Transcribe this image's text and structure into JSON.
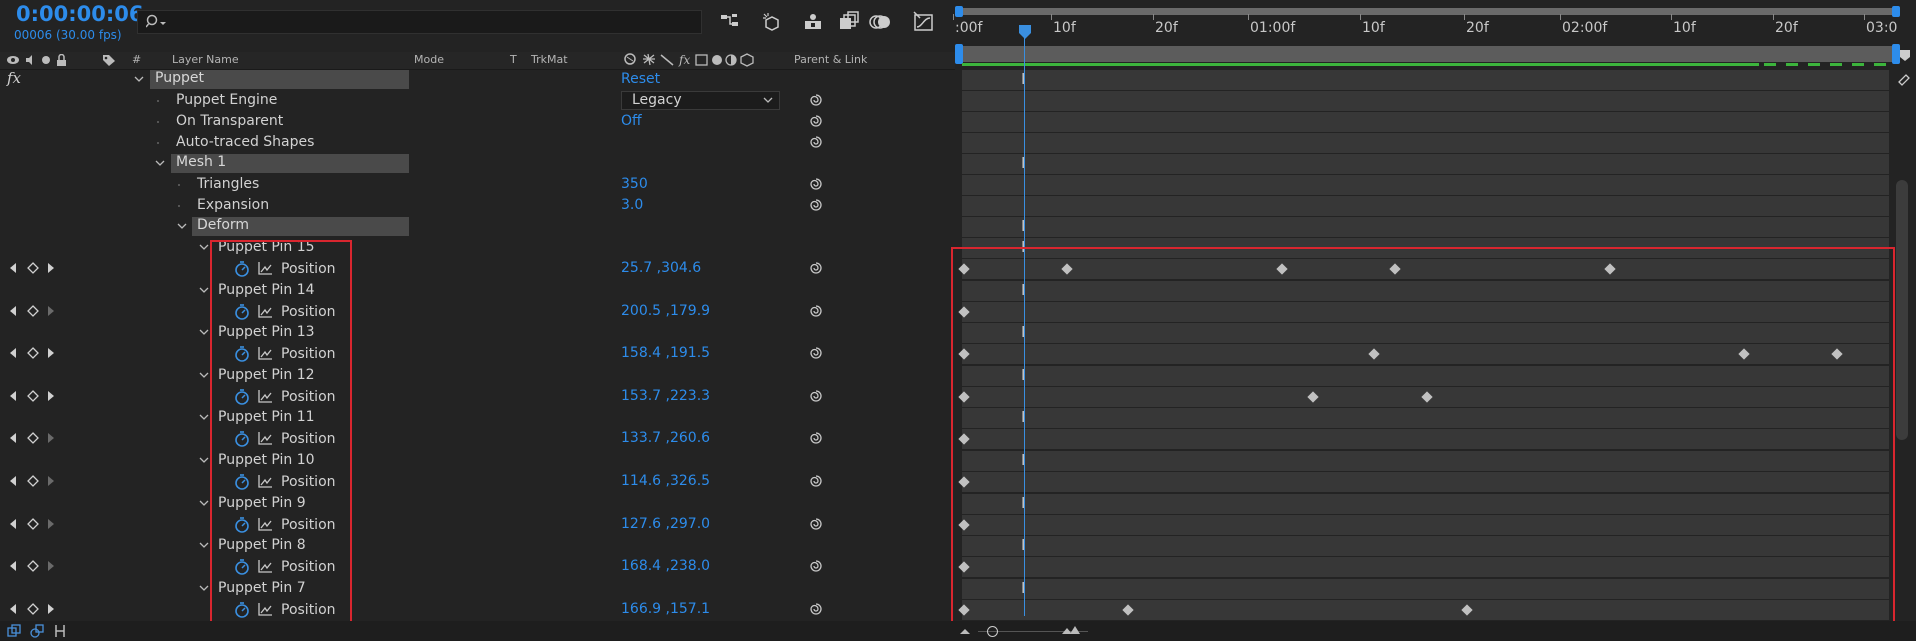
{
  "header": {
    "timecode": "0:00:00:06",
    "frames": "00006 (30.00 fps)"
  },
  "columns": {
    "layer_name": "Layer Name",
    "mode": "Mode",
    "t": "T",
    "trkmat": "TrkMat",
    "parent": "Parent & Link",
    "num": "#"
  },
  "effect": {
    "fx_label": "fx",
    "name": "Puppet",
    "reset": "Reset",
    "engine_label": "Puppet Engine",
    "engine_value": "Legacy",
    "on_transparent_label": "On Transparent",
    "on_transparent_value": "Off",
    "auto_traced_label": "Auto-traced Shapes",
    "mesh_label": "Mesh 1",
    "triangles_label": "Triangles",
    "triangles_value": "350",
    "expansion_label": "Expansion",
    "expansion_value": "3.0",
    "deform_label": "Deform"
  },
  "pins": [
    {
      "name": "Puppet Pin 15",
      "prop": "Position",
      "value": "25.7 ,304.6"
    },
    {
      "name": "Puppet Pin 14",
      "prop": "Position",
      "value": "200.5 ,179.9"
    },
    {
      "name": "Puppet Pin 13",
      "prop": "Position",
      "value": "158.4 ,191.5"
    },
    {
      "name": "Puppet Pin 12",
      "prop": "Position",
      "value": "153.7 ,223.3"
    },
    {
      "name": "Puppet Pin 11",
      "prop": "Position",
      "value": "133.7 ,260.6"
    },
    {
      "name": "Puppet Pin 10",
      "prop": "Position",
      "value": "114.6 ,326.5"
    },
    {
      "name": "Puppet Pin 9",
      "prop": "Position",
      "value": "127.6 ,297.0"
    },
    {
      "name": "Puppet Pin 8",
      "prop": "Position",
      "value": "168.4 ,238.0"
    },
    {
      "name": "Puppet Pin 7",
      "prop": "Position",
      "value": "166.9 ,157.1"
    }
  ],
  "ruler": {
    "ticks": [
      ":00f",
      "10f",
      "20f",
      "01:00f",
      "10f",
      "20f",
      "02:00f",
      "10f",
      "20f",
      "03:0"
    ]
  },
  "colors": {
    "accent": "#2d8ceb",
    "highlight": "#d9262f",
    "workarea": "#3cb43c"
  }
}
